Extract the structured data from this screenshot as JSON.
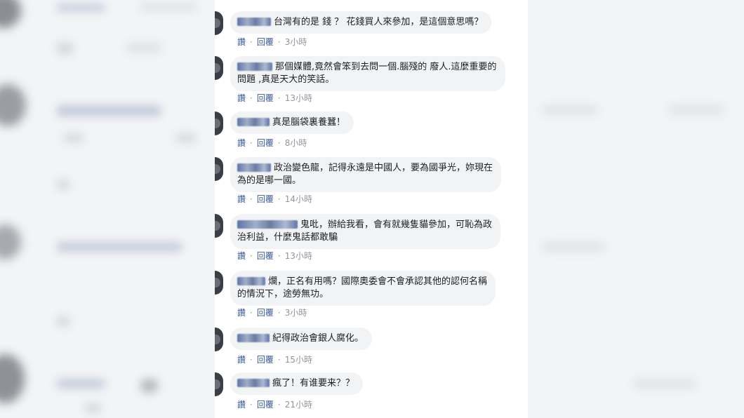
{
  "comments": [
    {
      "text": "台灣有的是 錢 ？ 花錢買人來參加，是這個意思嗎？",
      "like": "讚",
      "reply": "回覆",
      "time": "3小時"
    },
    {
      "text": "那個媒體,竟然會笨到去問一個.腦殘的 廢人.這麼重要的\n問題 ,真是天大的笑話。",
      "like": "讚",
      "reply": "回覆",
      "time": "13小時"
    },
    {
      "text": "真是腦袋裏養蠶！",
      "like": "讚",
      "reply": "回覆",
      "time": "8小時"
    },
    {
      "text": "政治變色龍，記得永遠是中國人，要為國爭光，妳現在\n為的是哪一國。",
      "like": "讚",
      "reply": "回覆",
      "time": "14小時"
    },
    {
      "text": "鬼吡，辦給我看，會有就幾隻貓參加，可恥為政\n治利益，什麼鬼話都敢騙",
      "like": "讚",
      "reply": "回覆",
      "time": "13小時"
    },
    {
      "text": "爛，正名有用嗎？國際奧委會不會承認其他的認何名稱\n的情況下，途勞無功。",
      "like": "讚",
      "reply": "回覆",
      "time": "3小時"
    },
    {
      "text": "紀得政治會銀人腐化。",
      "like": "讚",
      "reply": "回覆",
      "time": "15小時"
    },
    {
      "text": "瘋了！有谁要来？？",
      "like": "讚",
      "reply": "回覆",
      "time": "21小時"
    }
  ]
}
